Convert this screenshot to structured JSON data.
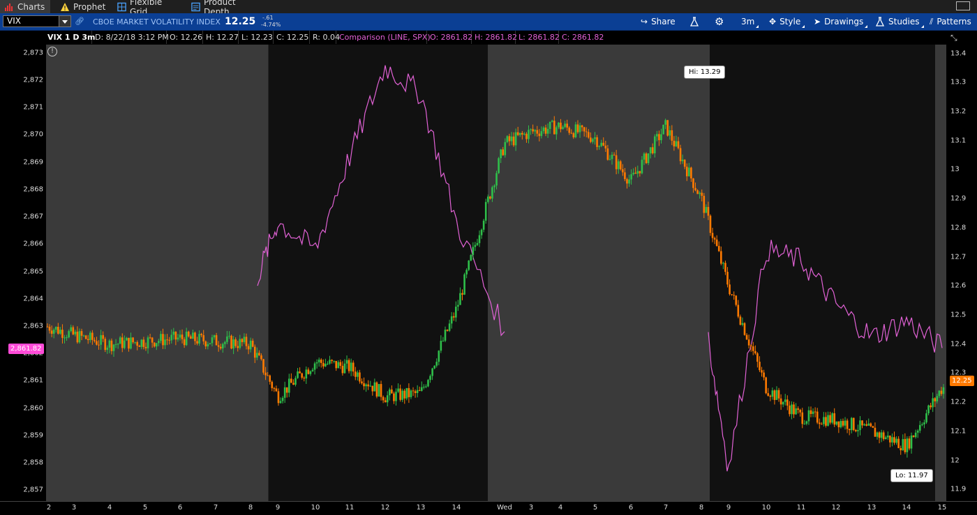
{
  "tabs": [
    {
      "label": "Charts",
      "icon": "bar-chart-icon",
      "active": true
    },
    {
      "label": "Prophet",
      "icon": "warning-triangle-icon",
      "active": false
    },
    {
      "label": "Flexible Grid",
      "icon": "grid-icon",
      "active": false
    },
    {
      "label": "Product Depth",
      "icon": "depth-icon",
      "active": false
    }
  ],
  "toolbar": {
    "symbol": "VIX",
    "instrument_name": "CBOE MARKET VOLATILITY INDEX",
    "last_price": "12.25",
    "change": "-.61",
    "change_pct": "-4.74%",
    "share_label": "Share",
    "timeframe_label": "3m",
    "style_label": "Style",
    "drawings_label": "Drawings",
    "studies_label": "Studies",
    "patterns_label": "Patterns"
  },
  "infobar": {
    "title": "VIX 1 D 3m",
    "date": "D: 8/22/18 3:12 PM",
    "open": "O: 12.26",
    "high": "H: 12.27",
    "low": "L: 12.23",
    "close": "C: 12.25",
    "range": "R: 0.04",
    "comparison": "Comparison (LINE, SPX)",
    "cmp_open": "O: 2861.82",
    "cmp_high": "H: 2861.82",
    "cmp_low": "L: 2861.82",
    "cmp_close": "C: 2861.82"
  },
  "left_axis_labels": [
    "2,873",
    "2,872",
    "2,871",
    "2,870",
    "2,869",
    "2,868",
    "2,867",
    "2,866",
    "2,865",
    "2,864",
    "2,863",
    "2,862",
    "2,861",
    "2,860",
    "2,859",
    "2,858",
    "2,857"
  ],
  "right_axis_labels": [
    "13.4",
    "13.3",
    "13.2",
    "13.1",
    "13",
    "12.9",
    "12.8",
    "12.7",
    "12.6",
    "12.5",
    "12.4",
    "12.3",
    "12.2",
    "12.1",
    "12",
    "11.9"
  ],
  "x_axis_labels": [
    "2",
    "3",
    "4",
    "5",
    "6",
    "7",
    "8",
    "9",
    "10",
    "11",
    "12",
    "13",
    "14",
    "Wed",
    "3",
    "4",
    "5",
    "6",
    "7",
    "8",
    "9",
    "10",
    "11",
    "12",
    "13",
    "14",
    "15"
  ],
  "comparison_price_tag": "2,861.82",
  "last_price_tag": "12.25",
  "hi_callout": "Hi: 13.29",
  "lo_callout": "Lo: 11.97",
  "colors": {
    "up": "#2fbf4a",
    "down": "#ff7a00",
    "comparison": "#e262d6",
    "extended_hours_bg": "#3a3a3a",
    "regular_hours_bg": "#111111",
    "toolbar_bg": "#0b3f94"
  },
  "chart_data": {
    "type": "line",
    "title": "VIX 1 D 3m",
    "series": [
      {
        "name": "VIX",
        "style": "candlestick",
        "x": [
          "2",
          "3",
          "4",
          "5",
          "6",
          "7",
          "8",
          "9",
          "10",
          "11",
          "12",
          "13",
          "14",
          "Wed",
          "3",
          "4",
          "5",
          "6",
          "7",
          "8",
          "9",
          "10",
          "11",
          "12",
          "13",
          "14",
          "15"
        ],
        "values": [
          12.46,
          12.43,
          12.4,
          12.41,
          12.42,
          12.41,
          12.4,
          12.22,
          12.34,
          12.32,
          12.22,
          12.23,
          12.52,
          13.09,
          13.13,
          13.15,
          13.11,
          12.96,
          13.15,
          12.9,
          12.6,
          12.25,
          12.15,
          12.14,
          12.1,
          12.05,
          12.25
        ]
      },
      {
        "name": "SPX",
        "style": "line",
        "x": [
          "8",
          "9",
          "10",
          "11",
          "12",
          "13",
          "14",
          "Wed",
          "8",
          "9",
          "10",
          "11",
          "12",
          "13",
          "14",
          "15"
        ],
        "values": [
          2864.8,
          2866.8,
          2865.8,
          2869.2,
          2872.5,
          2871.5,
          2866.8,
          2862.8,
          2862.5,
          2857.8,
          2865.8,
          2865.4,
          2863.8,
          2862.6,
          2863.2,
          2862.2
        ]
      }
    ],
    "ylim_left": [
      2856.6,
      2873.3
    ],
    "ylim_right": [
      11.86,
      13.43
    ],
    "grid": false,
    "hi": 13.29,
    "lo": 11.97,
    "last": 12.25,
    "comparison_last": 2861.82
  }
}
